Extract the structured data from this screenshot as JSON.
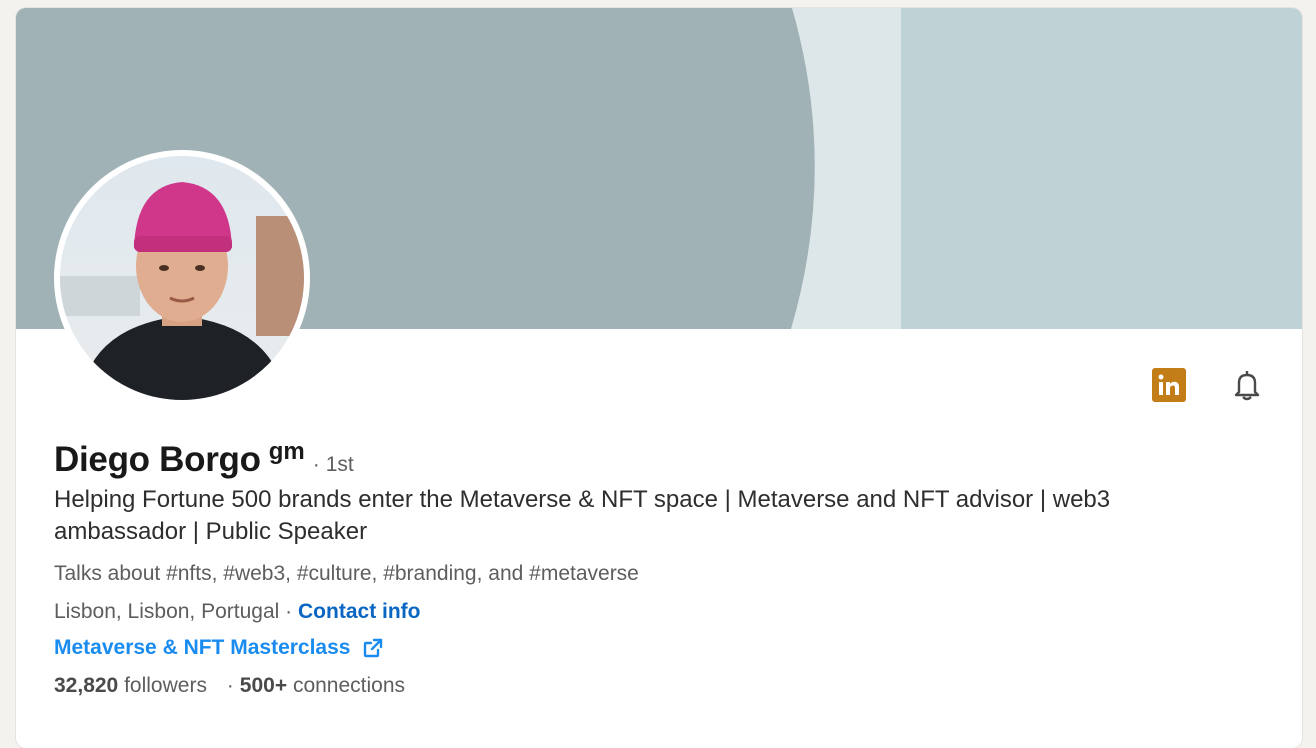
{
  "profile": {
    "name": "Diego Borgo",
    "pronoun": "gm",
    "degree_sep": "·",
    "degree": "1st",
    "headline": "Helping Fortune 500 brands enter the Metaverse & NFT space | Metaverse and NFT advisor | web3 ambassador | Public Speaker",
    "talks_about": "Talks about #nfts, #web3, #culture, #branding, and #metaverse",
    "location": "Lisbon, Lisbon, Portugal",
    "location_sep": "·",
    "contact_label": "Contact info",
    "website_label": "Metaverse & NFT Masterclass",
    "followers_count": "32,820",
    "followers_label": "followers",
    "stats_sep": "·",
    "connections_count": "500+",
    "connections_label": "connections"
  },
  "icons": {
    "linkedin": "linkedin-icon",
    "bell": "bell-icon",
    "external_link": "external-link-icon"
  },
  "colors": {
    "link_blue": "#0a66c2",
    "website_blue": "#1a8cf0",
    "linkedin_badge": "#c37d16",
    "banner_dark": "#a0b2b5",
    "banner_light": "#bfd2d6"
  }
}
